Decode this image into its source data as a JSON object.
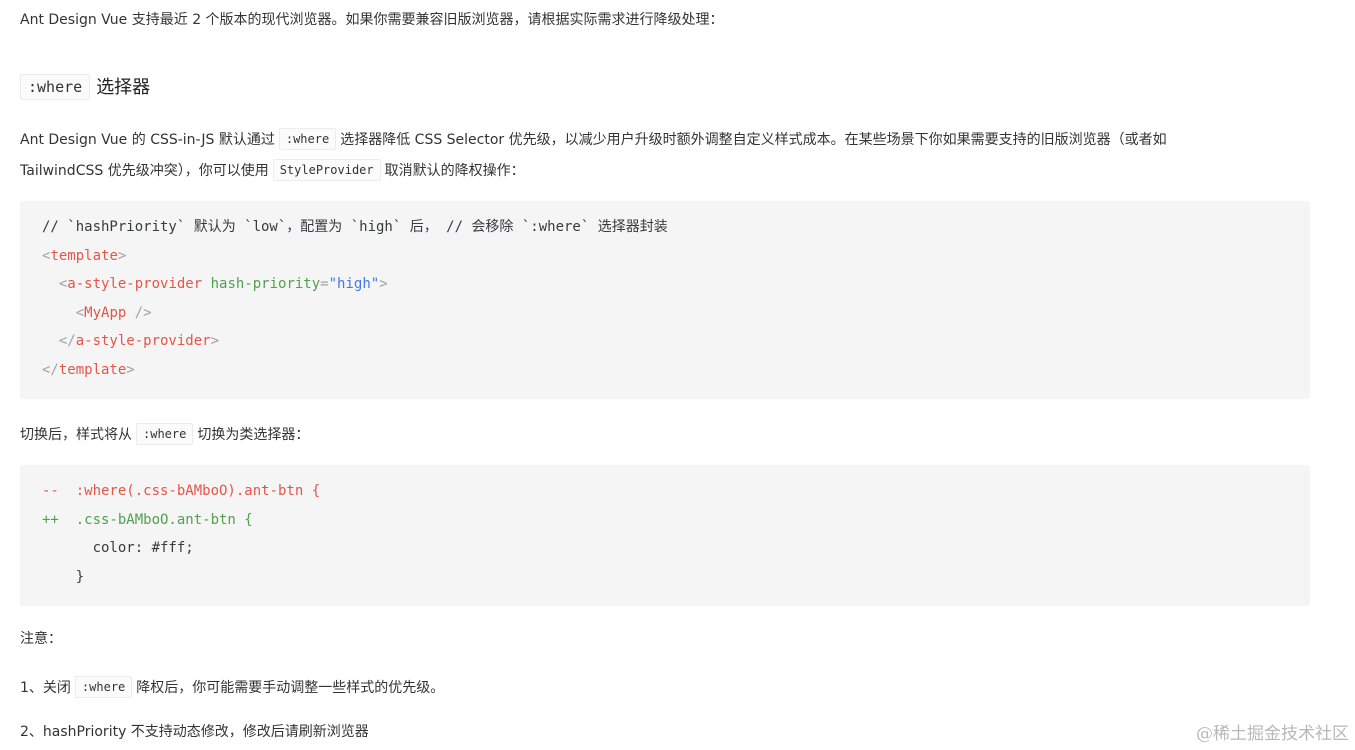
{
  "intro": {
    "text": "Ant Design Vue 支持最近 2 个版本的现代浏览器。如果你需要兼容旧版浏览器，请根据实际需求进行降级处理："
  },
  "section": {
    "title_code": ":where",
    "title_text": "选择器"
  },
  "desc": {
    "line1_part1": "Ant Design Vue 的 CSS-in-JS 默认通过",
    "line1_code": ":where",
    "line1_part2": "选择器降低 CSS Selector 优先级，以减少用户升级时额外调整自定义样式成本。在某些场景下你如果需要支持的旧版浏览器（或者如",
    "line2_part1": "TailwindCSS 优先级冲突），你可以使用",
    "line2_code": "StyleProvider",
    "line2_part2": "取消默认的降权操作："
  },
  "code1": {
    "comment": "// `hashPriority` 默认为 `low`，配置为 `high` 后， // 会移除 `:where` 选择器封装",
    "lt": "<",
    "gt": ">",
    "lt_slash": "</",
    "self_close": " />",
    "tag_template": "template",
    "tag_provider": "a-style-provider",
    "attr_name": "hash-priority",
    "attr_eq": "=",
    "attr_value": "\"high\"",
    "tag_myapp": "MyApp"
  },
  "switch_text": {
    "part1": "切换后，样式将从",
    "code": ":where",
    "part2": "切换为类选择器："
  },
  "code2": {
    "del_line": "--  :where(.css-bAMboO).ant-btn {",
    "add_line": "++  .css-bAMboO.ant-btn {",
    "body_line": "      color: #fff;",
    "close_line": "    }"
  },
  "notes": {
    "title": "注意：",
    "item1_part1": "1、关闭",
    "item1_code": ":where",
    "item1_part2": "降权后，你可能需要手动调整一些样式的优先级。",
    "item2": "2、hashPriority 不支持动态修改，修改后请刷新浏览器"
  },
  "watermark": "@稀土掘金技术社区"
}
